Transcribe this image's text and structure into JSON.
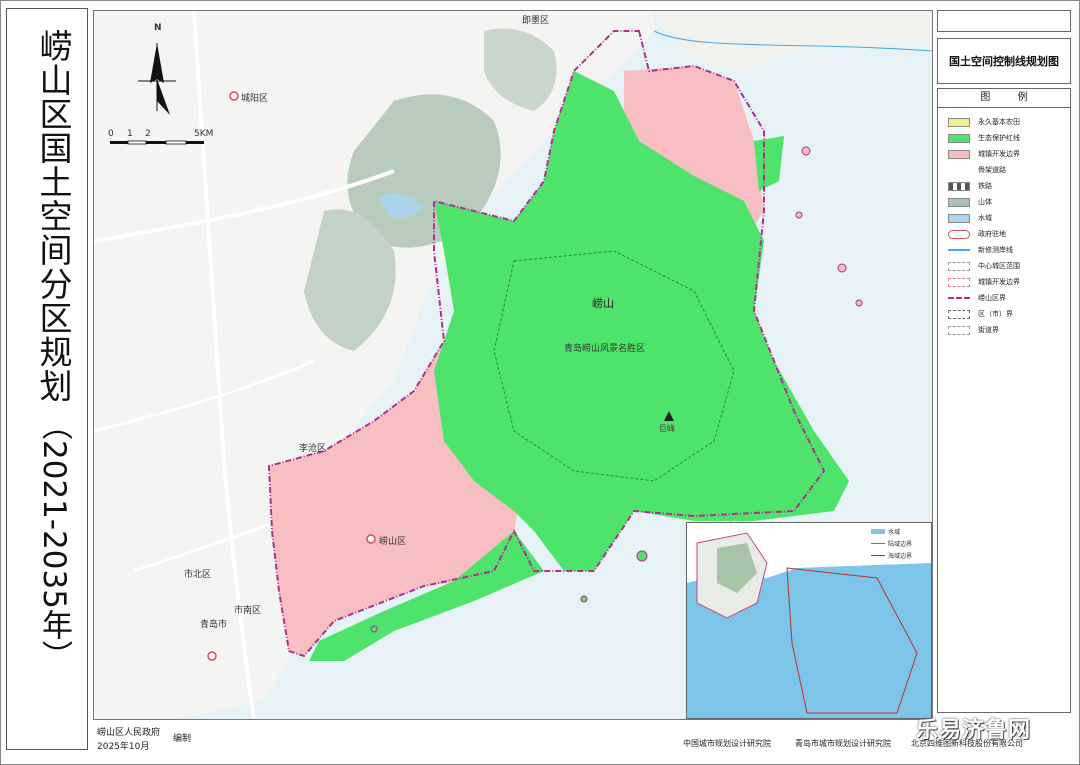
{
  "title": {
    "main": "崂山区国土空间分区规划",
    "years": "（2021-2035年）"
  },
  "map_title": "国土空间控制线规划图",
  "compass": {
    "north_label": "N"
  },
  "scale": {
    "ticks": [
      "0",
      "1",
      "2",
      "5KM"
    ]
  },
  "place_labels": {
    "laoshan": "崂山",
    "scenic": "青岛崂山风景名胜区",
    "laoshan_district": "崂山区",
    "licang": "李沧区",
    "chengyang": "城阳区",
    "shibei": "市北区",
    "shinan": "市南区",
    "qingdao": "青岛市",
    "jimo": "即墨区",
    "peak": "巨峰"
  },
  "legend": {
    "heading": "图 例",
    "items": [
      {
        "label": "永久基本农田",
        "color": "#f2f28a"
      },
      {
        "label": "生态保护红线",
        "color": "#4ee36a"
      },
      {
        "label": "城镇开发边界",
        "color": "#f7bfc2"
      },
      {
        "label": "骨架道路",
        "color": "#ffffff"
      },
      {
        "label": "铁路",
        "color": "#555555"
      },
      {
        "label": "山体",
        "color": "#a8c4b2"
      },
      {
        "label": "水域",
        "color": "#a9d4ec"
      },
      {
        "label": "政府驻地",
        "color": "#d0505a"
      },
      {
        "label": "新修测岸线",
        "color": "#4aa8e0"
      },
      {
        "label": "中心城区范围",
        "color": "#999999"
      },
      {
        "label": "城镇开发边界",
        "color": "#d08080"
      },
      {
        "label": "崂山区界",
        "color": "#b03090"
      },
      {
        "label": "区（市）界",
        "color": "#666666"
      },
      {
        "label": "街道界",
        "color": "#999999"
      }
    ]
  },
  "inset_legend": [
    {
      "label": "水域",
      "color": "#7cc4e8"
    },
    {
      "label": "陆域边界",
      "color": "#d04080"
    },
    {
      "label": "海域边界",
      "color": "#c03030"
    }
  ],
  "footer": {
    "gov": "崂山区人民政府",
    "date": "2025年10月",
    "compile": "编制",
    "inst1": "中国城市规划设计研究院",
    "inst2": "青岛市城市规划设计研究院",
    "inst3": "北京四维图新科技股份有限公司"
  },
  "watermark": "乐易济鲁网"
}
